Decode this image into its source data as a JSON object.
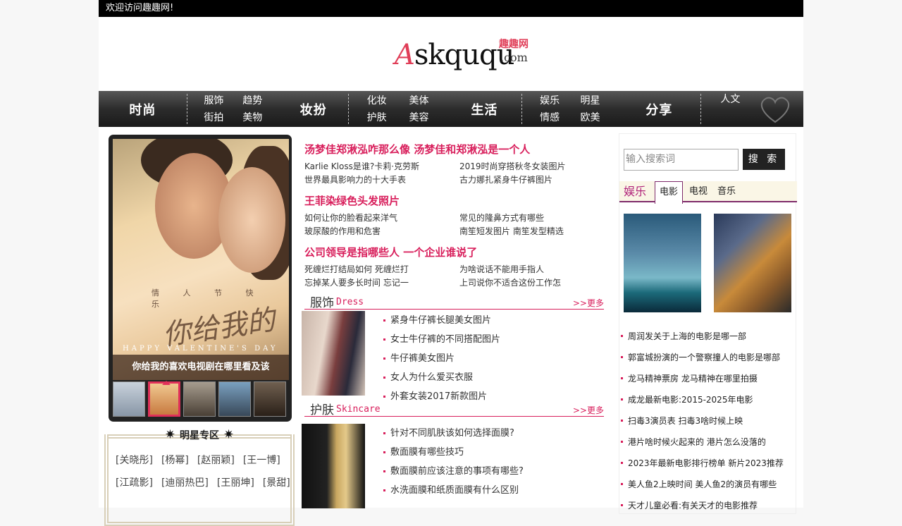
{
  "topbar": {
    "welcome": "欢迎访问趣趣网!"
  },
  "logo": {
    "main_a": "A",
    "main_rest": "skququ",
    "cn": "趣趣网",
    "com": ".com"
  },
  "nav": {
    "groups": [
      {
        "title": "时尚",
        "links": [
          "服饰",
          "趋势",
          "街拍",
          "美物"
        ]
      },
      {
        "title": "妆扮",
        "links": [
          "化妆",
          "美体",
          "护肤",
          "美容"
        ]
      },
      {
        "title": "生活",
        "links": [
          "娱乐",
          "明星",
          "情感",
          "欧美"
        ]
      },
      {
        "title": "分享",
        "links": [
          "人文"
        ]
      }
    ]
  },
  "slider": {
    "poster_vertical": "情 人 节 快 乐",
    "poster_calligraphy": "你给我的",
    "poster_happy": "HAPPY VALENTINE'S DAY",
    "caption": "你给我的喜欢电视剧在哪里看及该"
  },
  "stars": {
    "title": "明星专区",
    "names": [
      "[关晓彤]",
      "[杨幂]",
      "[赵丽颖]",
      "[王一博]",
      "[江疏影]",
      "[迪丽热巴]",
      "[王丽坤]",
      "[景甜]"
    ]
  },
  "headlines": [
    {
      "title": "汤梦佳郑湫泓咋那么像 汤梦佳和郑湫泓是一个人",
      "links": [
        "Karlie Kloss是谁?卡莉·克劳斯",
        "2019时尚穿搭秋冬女装图片",
        "世界最具影响力的十大手表",
        "古力娜扎紧身牛仔裤图片"
      ]
    },
    {
      "title": "王菲染绿色头发照片",
      "links": [
        "如何让你的脸看起来洋气",
        "常见的隆鼻方式有哪些",
        "玻尿酸的作用和危害",
        "南笙短发图片 南笙发型精选"
      ]
    },
    {
      "title": "公司领导是指哪些人 一个企业谁说了",
      "links": [
        "死缠烂打结局如何 死缠烂打",
        "为啥说话不能用手指人",
        "忘掉某人要多长时间 忘记一",
        "上司说你不适合这份工作怎"
      ]
    }
  ],
  "sections": [
    {
      "cn": "服饰",
      "en": "Dress",
      "more": ">>更多",
      "items": [
        "紧身牛仔裤长腿美女图片",
        "女士牛仔裤的不同搭配图片",
        "牛仔裤美女图片",
        "女人为什么爱买衣服",
        "外套女装2017新款图片"
      ]
    },
    {
      "cn": "护肤",
      "en": "Skincare",
      "more": ">>更多",
      "items": [
        "针对不同肌肤该如何选择面膜?",
        "敷面膜有哪些技巧",
        "敷面膜前应该注意的事项有哪些?",
        "水洗面膜和纸质面膜有什么区别"
      ]
    }
  ],
  "search": {
    "placeholder": "输入搜索词",
    "button": "搜 索"
  },
  "entertainment": {
    "title": "娱乐",
    "tabs": [
      "电影",
      "电视",
      "音乐"
    ],
    "active_tab": "电影",
    "movies": [
      "周润发关于上海的电影是哪一部",
      "郭富城扮演的一个警察撞人的电影是哪部",
      "龙马精神票房 龙马精神在哪里拍摄",
      "成龙最新电影:2015-2025年电影",
      "扫毒3演员表 扫毒3啥时候上映",
      "港片啥时候火起来的 港片怎么没落的",
      "2023年最新电影排行榜单 新片2023推荐",
      "美人鱼2上映时间 美人鱼2的演员有哪些",
      "天才儿童必看:有关天才的电影推荐"
    ]
  }
}
